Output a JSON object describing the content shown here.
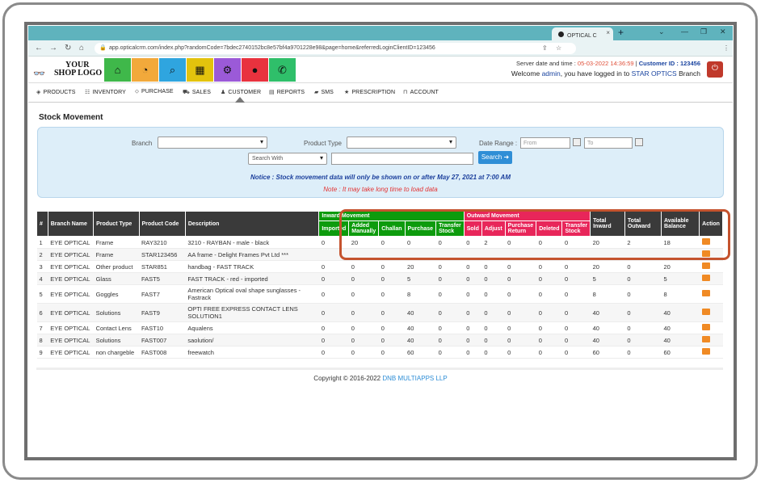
{
  "browser": {
    "tab_title": "OPTICAL C",
    "url": "app.opticalcrm.com/index.php?randomCode=7bdec2740152bc8e57bf4a9701228e98&page=home&referredLoginClientID=123456"
  },
  "logo": {
    "line1": "YOUR",
    "line2": "SHOP LOGO"
  },
  "header": {
    "server_label": "Server date and time :",
    "server_time": "05-03-2022 14:36:59",
    "customer_id_label": "Customer ID : 123456",
    "welcome_pre": "Welcome",
    "user": "admin",
    "welcome_mid": ", you have logged in to",
    "branch": "STAR OPTICS",
    "welcome_post": "Branch"
  },
  "nav": {
    "products": "PRODUCTS",
    "inventory": "INVENTORY",
    "purchase": "PURCHASE",
    "sales": "SALES",
    "customer": "CUSTOMER",
    "reports": "REPORTS",
    "sms": "SMS",
    "prescription": "PRESCRIPTION",
    "account": "ACCOUNT"
  },
  "page_title": "Stock Movement",
  "filters": {
    "branch_label": "Branch",
    "product_type_label": "Product Type",
    "date_range_label": "Date Range :",
    "from_placeholder": "From",
    "to_placeholder": "To",
    "search_with": "Search With",
    "search_button": "Search",
    "notice": "Notice : Stock movement data will only be shown on or after May 27, 2021 at 7:00 AM",
    "note": "Note : It may take long time to load data"
  },
  "table": {
    "headers": {
      "num": "#",
      "branch": "Branch Name",
      "ptype": "Product Type",
      "pcode": "Product Code",
      "desc": "Description",
      "inward": "Inward Movement",
      "outward": "Outward Movement",
      "total_inward": "Total Inward",
      "total_outward": "Total Outward",
      "available": "Available Balance",
      "action": "Action",
      "imported": "Imported",
      "added": "Added Manually",
      "challan": "Challan",
      "purchase": "Purchase",
      "transfer_in": "Transfer Stock",
      "sold": "Sold",
      "adjust": "Adjust",
      "preturn": "Purchase Return",
      "deleted": "Deleted",
      "transfer_out": "Transfer Stock"
    },
    "rows": [
      [
        "1",
        "EYE OPTICAL",
        "Frame",
        "RAY3210",
        "3210 - RAYBAN - male - black",
        "0",
        "20",
        "0",
        "0",
        "0",
        "0",
        "2",
        "0",
        "0",
        "0",
        "20",
        "2",
        "18"
      ],
      [
        "2",
        "EYE OPTICAL",
        "Frame",
        "STAR123456",
        "AA frame - Delight Frames Pvt Ltd ***",
        "",
        "",
        "",
        "",
        "",
        "",
        "",
        "",
        "",
        "",
        "",
        "",
        ""
      ],
      [
        "3",
        "EYE OPTICAL",
        "Other product",
        "STAR851",
        "handbag - FAST TRACK",
        "0",
        "0",
        "0",
        "20",
        "0",
        "0",
        "0",
        "0",
        "0",
        "0",
        "20",
        "0",
        "20"
      ],
      [
        "4",
        "EYE OPTICAL",
        "Glass",
        "FAST5",
        "FAST TRACK - red - imported",
        "0",
        "0",
        "0",
        "5",
        "0",
        "0",
        "0",
        "0",
        "0",
        "0",
        "5",
        "0",
        "5"
      ],
      [
        "5",
        "EYE OPTICAL",
        "Goggles",
        "FAST7",
        "American Optical oval shape sunglasses - Fastrack",
        "0",
        "0",
        "0",
        "8",
        "0",
        "0",
        "0",
        "0",
        "0",
        "0",
        "8",
        "0",
        "8"
      ],
      [
        "6",
        "EYE OPTICAL",
        "Solutions",
        "FAST9",
        "OPTI FREE EXPRESS CONTACT LENS SOLUTION1",
        "0",
        "0",
        "0",
        "40",
        "0",
        "0",
        "0",
        "0",
        "0",
        "0",
        "40",
        "0",
        "40"
      ],
      [
        "7",
        "EYE OPTICAL",
        "Contact Lens",
        "FAST10",
        "Aqualens",
        "0",
        "0",
        "0",
        "40",
        "0",
        "0",
        "0",
        "0",
        "0",
        "0",
        "40",
        "0",
        "40"
      ],
      [
        "8",
        "EYE OPTICAL",
        "Solutions",
        "FAST007",
        "saolution/",
        "0",
        "0",
        "0",
        "40",
        "0",
        "0",
        "0",
        "0",
        "0",
        "0",
        "40",
        "0",
        "40"
      ],
      [
        "9",
        "EYE OPTICAL",
        "non chargeble",
        "FAST008",
        "freewatch",
        "0",
        "0",
        "0",
        "60",
        "0",
        "0",
        "0",
        "0",
        "0",
        "0",
        "60",
        "0",
        "60"
      ]
    ]
  },
  "footer": {
    "copyright": "Copyright © 2016-2022",
    "company": "DNB MULTIAPPS LLP"
  },
  "colors": {
    "inward": "#0d9b0d",
    "outward": "#e8265a",
    "highlight": "#c5532e",
    "accent": "#2f8ed6"
  }
}
